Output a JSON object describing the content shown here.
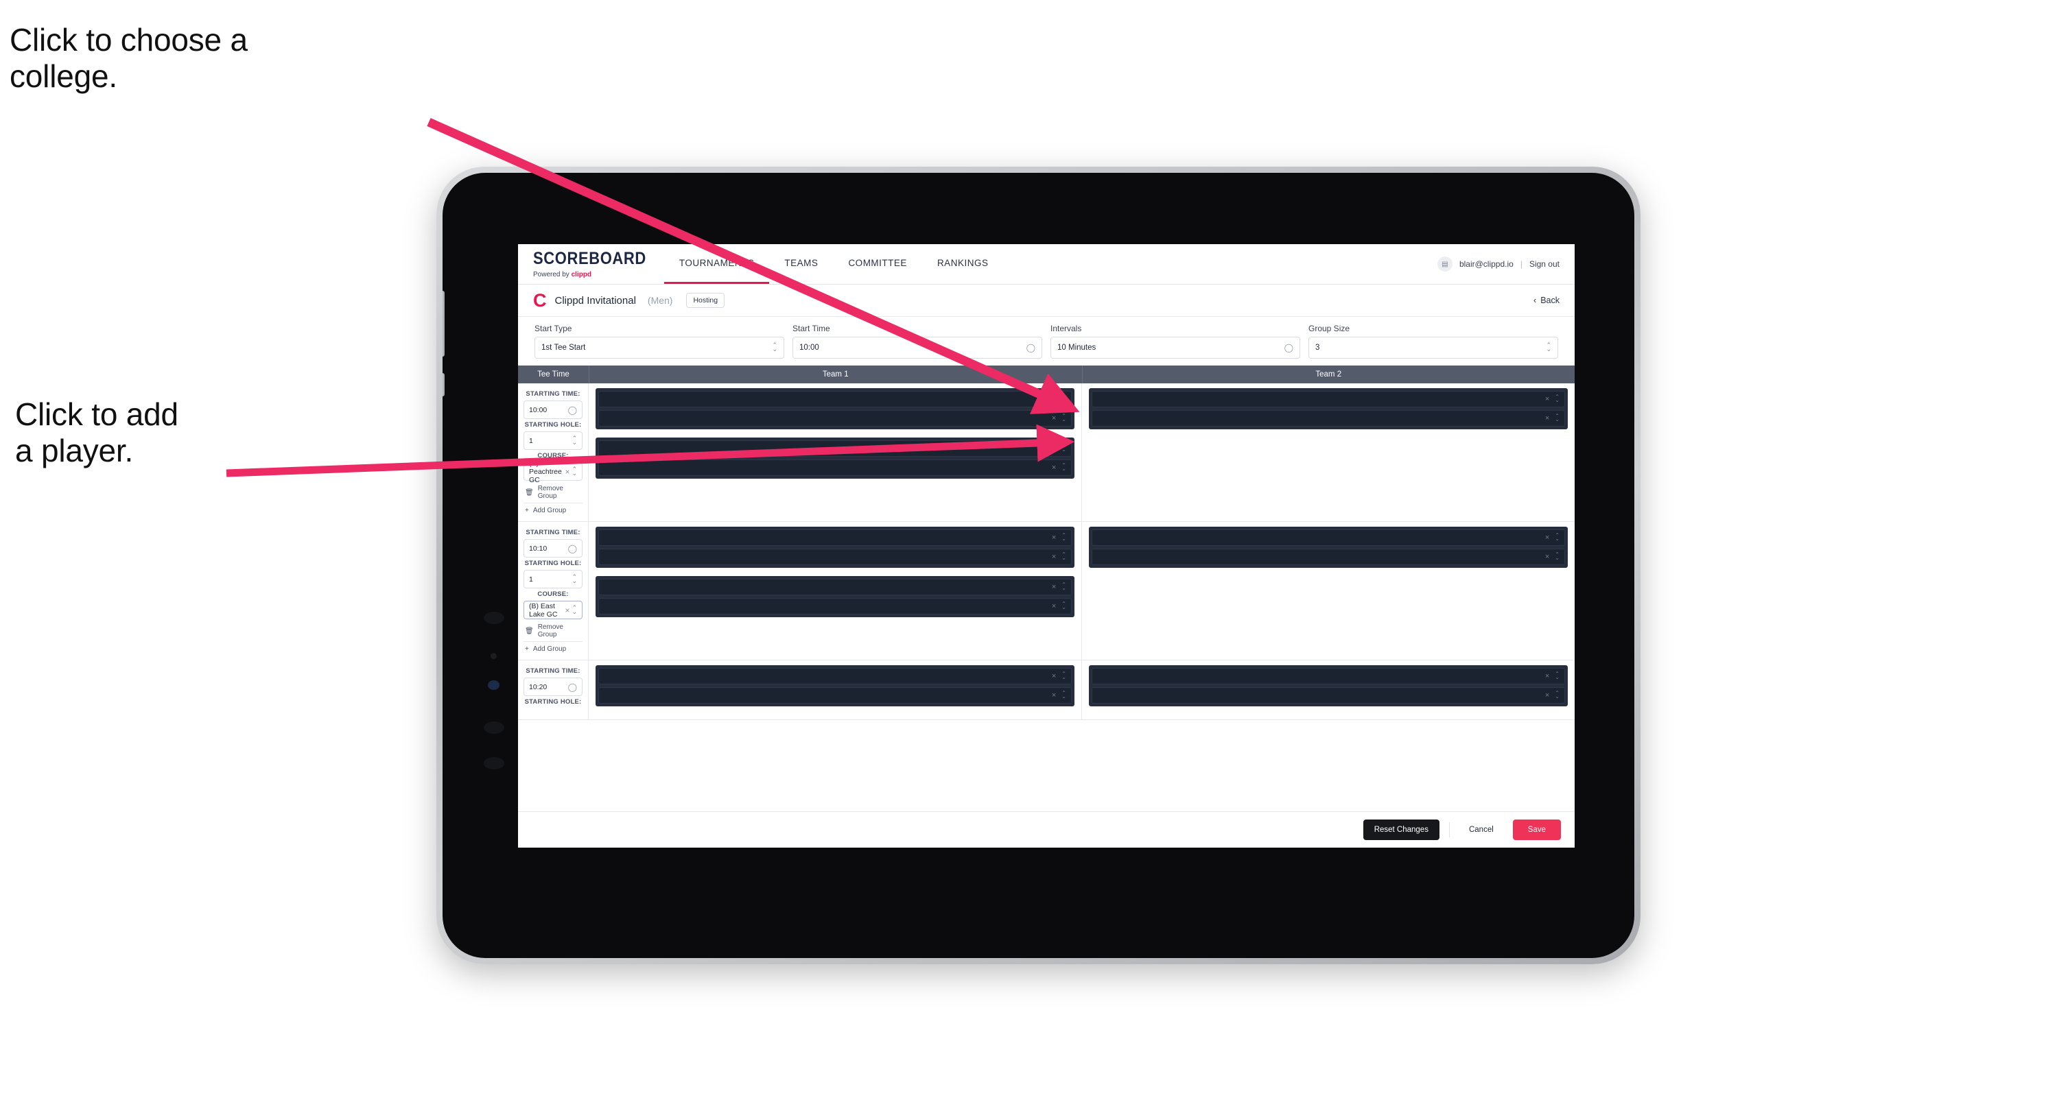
{
  "annotations": {
    "choose_college": "Click to choose a\ncollege.",
    "add_player": "Click to add\na player.",
    "arrow_color": "#ec2a63"
  },
  "nav": {
    "brand": {
      "name": "SCOREBOARD",
      "powered_prefix": "Powered by",
      "powered_brand": "clippd"
    },
    "items": [
      {
        "label": "TOURNAMENTS",
        "active": true
      },
      {
        "label": "TEAMS",
        "active": false
      },
      {
        "label": "COMMITTEE",
        "active": false
      },
      {
        "label": "RANKINGS",
        "active": false
      }
    ],
    "account": {
      "avatar_glyph": "▤",
      "email": "blair@clippd.io",
      "separator": "|",
      "sign_out": "Sign out"
    }
  },
  "tournament_bar": {
    "logo_letter": "C",
    "name": "Clippd Invitational",
    "gender": "(Men)",
    "badge": "Hosting",
    "back": "Back",
    "back_chevron": "‹"
  },
  "controls": [
    {
      "label": "Start Type",
      "value": "1st Tee Start",
      "icon": "stepper-icon"
    },
    {
      "label": "Start Time",
      "value": "10:00",
      "icon": "clock-icon"
    },
    {
      "label": "Intervals",
      "value": "10 Minutes",
      "icon": "clock-icon"
    },
    {
      "label": "Group Size",
      "value": "3",
      "icon": "stepper-icon"
    }
  ],
  "table": {
    "headers": [
      "Tee Time",
      "Team 1",
      "Team 2"
    ],
    "field_labels": {
      "starting_time": "STARTING TIME:",
      "starting_hole": "STARTING HOLE:",
      "course": "COURSE:"
    },
    "group_actions": {
      "remove": "Remove Group",
      "add": "Add Group",
      "remove_icon": "trash-icon",
      "add_icon": "plus-icon"
    },
    "rows": [
      {
        "starting_time": "10:00",
        "starting_hole": "1",
        "course": "(A) Peachtree GC",
        "course_focused": false,
        "team1_groups": [
          {
            "players": [
              "",
              ""
            ]
          },
          {
            "players": [
              "",
              ""
            ]
          }
        ],
        "team2_groups": [
          {
            "players": [
              "",
              ""
            ]
          }
        ]
      },
      {
        "starting_time": "10:10",
        "starting_hole": "1",
        "course": "(B) East Lake GC",
        "course_focused": true,
        "team1_groups": [
          {
            "players": [
              "",
              ""
            ]
          },
          {
            "players": [
              "",
              ""
            ]
          }
        ],
        "team2_groups": [
          {
            "players": [
              "",
              ""
            ]
          }
        ]
      },
      {
        "starting_time": "10:20",
        "starting_hole": "",
        "course": "",
        "course_focused": false,
        "partial": true,
        "team1_groups": [
          {
            "players": [
              "",
              ""
            ]
          }
        ],
        "team2_groups": [
          {
            "players": [
              "",
              ""
            ]
          }
        ]
      }
    ],
    "clear_icon": "×",
    "stepper_up": "⌃",
    "stepper_down": "⌄"
  },
  "footer": {
    "reset": "Reset Changes",
    "cancel": "Cancel",
    "save": "Save"
  },
  "colors": {
    "accent_pink": "#e8174c",
    "save_pink": "#ef3257",
    "table_header": "#545b6b",
    "group_bg": "#262e3d",
    "player_row_bg": "#1b2230"
  }
}
